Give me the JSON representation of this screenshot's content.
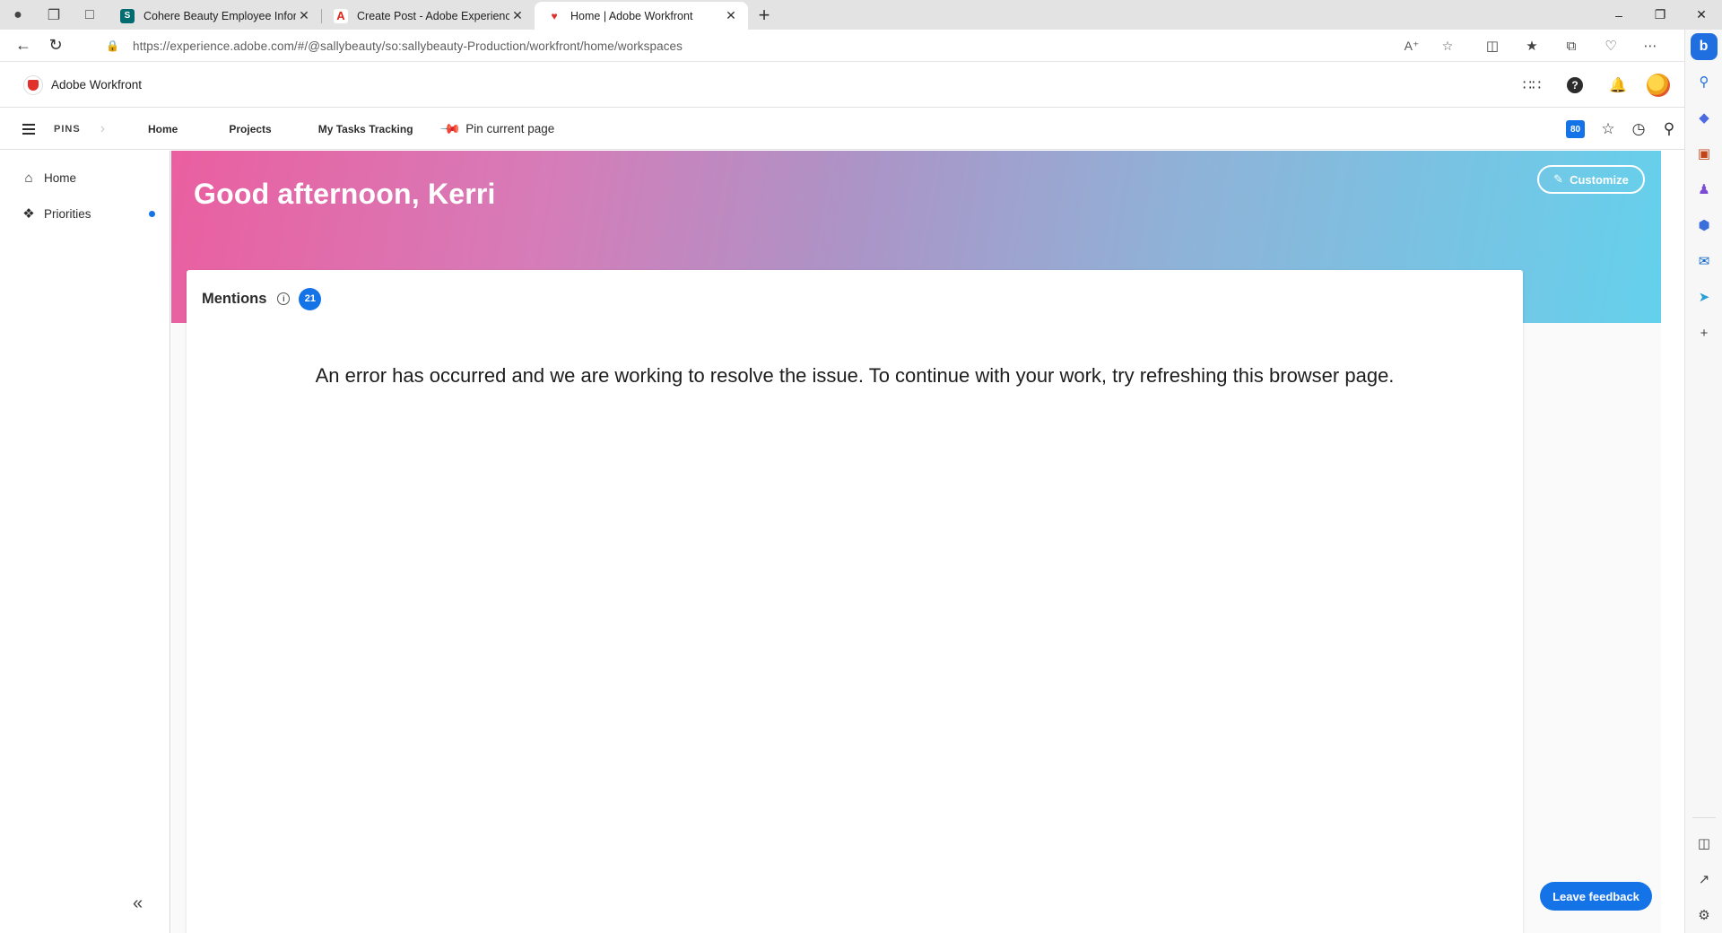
{
  "browser": {
    "tabs": [
      {
        "title": "Cohere Beauty Employee Inform",
        "favicon": "sharepoint-icon",
        "color": "#036c70"
      },
      {
        "title": "Create Post - Adobe Experience",
        "favicon": "adobe-icon",
        "color": "#e1251b"
      },
      {
        "title": "Home | Adobe Workfront",
        "favicon": "workfront-icon",
        "color": "#e0322b"
      }
    ],
    "new_tab": "+",
    "url": "https://experience.adobe.com/#/@sallybeauty/so:sallybeauty-Production/workfront/home/workspaces"
  },
  "app": {
    "name": "Adobe Workfront"
  },
  "pinbar": {
    "pins_label": "PINS",
    "links": [
      "Home",
      "Projects",
      "My Tasks Tracking"
    ],
    "pin_current": "Pin current page",
    "count": "80"
  },
  "leftnav": {
    "items": [
      {
        "label": "Home",
        "icon": "home-icon"
      },
      {
        "label": "Priorities",
        "icon": "priorities-icon",
        "has_dot": true
      }
    ],
    "collapse": "«"
  },
  "main": {
    "greeting": "Good afternoon, Kerri",
    "customize_label": "Customize",
    "mentions": {
      "title": "Mentions",
      "count": "21"
    },
    "error_message": "An error has occurred and we are working to resolve the issue. To continue with your work, try refreshing this browser page.",
    "feedback_label": "Leave feedback"
  },
  "colors": {
    "accent": "#1473e6",
    "banner_start": "#ea5fa0",
    "banner_end": "#64d1ec"
  }
}
